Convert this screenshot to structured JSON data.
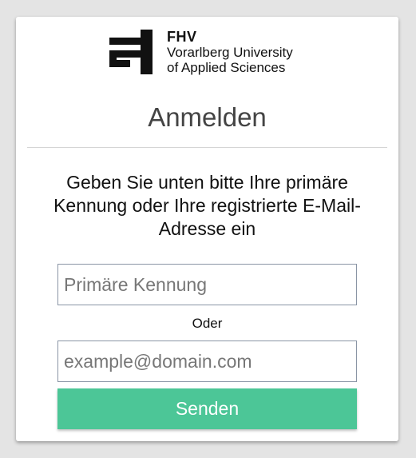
{
  "logo": {
    "abbreviation": "FHV",
    "line1": "Vorarlberg University",
    "line2": "of Applied Sciences"
  },
  "page": {
    "title": "Anmelden",
    "instruction": "Geben Sie unten bitte Ihre primäre Kennung oder Ihre registrierte E-Mail-Adresse ein"
  },
  "form": {
    "primary_id": {
      "value": "",
      "placeholder": "Primäre Kennung"
    },
    "separator": "Oder",
    "email": {
      "value": "",
      "placeholder": "example@domain.com"
    },
    "submit_label": "Senden"
  },
  "colors": {
    "accent": "#4cc697",
    "background": "#e4e4e4",
    "card": "#ffffff",
    "input_border": "#8a95a5"
  }
}
